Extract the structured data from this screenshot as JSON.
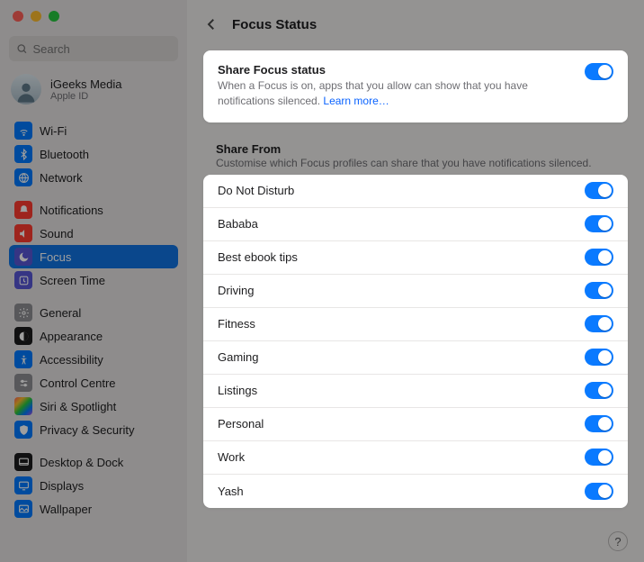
{
  "colors": {
    "accent": "#0a7aff",
    "link": "#0a63ff"
  },
  "search": {
    "placeholder": "Search"
  },
  "account": {
    "name": "iGeeks Media",
    "sub": "Apple ID"
  },
  "sidebar": {
    "items": [
      {
        "label": "Wi-Fi"
      },
      {
        "label": "Bluetooth"
      },
      {
        "label": "Network"
      },
      {
        "label": "Notifications"
      },
      {
        "label": "Sound"
      },
      {
        "label": "Focus"
      },
      {
        "label": "Screen Time"
      },
      {
        "label": "General"
      },
      {
        "label": "Appearance"
      },
      {
        "label": "Accessibility"
      },
      {
        "label": "Control Centre"
      },
      {
        "label": "Siri & Spotlight"
      },
      {
        "label": "Privacy & Security"
      },
      {
        "label": "Desktop & Dock"
      },
      {
        "label": "Displays"
      },
      {
        "label": "Wallpaper"
      }
    ]
  },
  "page": {
    "title": "Focus Status",
    "share_card": {
      "title": "Share Focus status",
      "desc": "When a Focus is on, apps that you allow can show that you have notifications silenced. ",
      "link": "Learn more…",
      "enabled": true
    },
    "section": {
      "title": "Share From",
      "desc": "Customise which Focus profiles can share that you have notifications silenced."
    },
    "profiles": [
      {
        "label": "Do Not Disturb",
        "enabled": true
      },
      {
        "label": "Bababa",
        "enabled": true
      },
      {
        "label": "Best ebook tips",
        "enabled": true
      },
      {
        "label": "Driving",
        "enabled": true
      },
      {
        "label": "Fitness",
        "enabled": true
      },
      {
        "label": "Gaming",
        "enabled": true
      },
      {
        "label": "Listings",
        "enabled": true
      },
      {
        "label": "Personal",
        "enabled": true
      },
      {
        "label": "Work",
        "enabled": true
      },
      {
        "label": "Yash",
        "enabled": true
      }
    ],
    "help": "?"
  }
}
